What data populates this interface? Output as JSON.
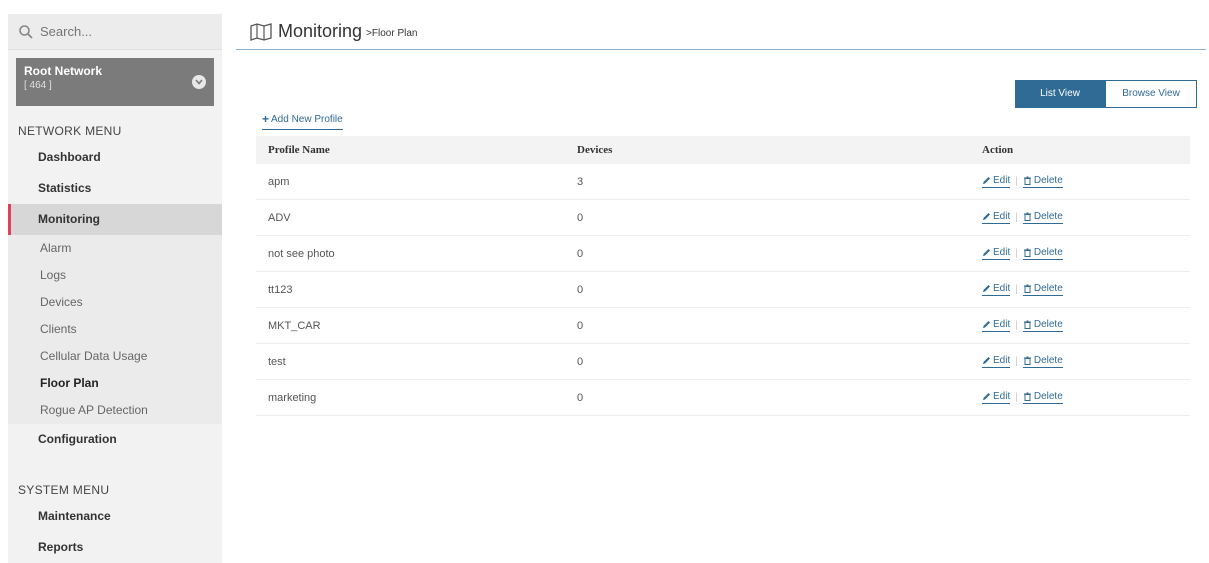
{
  "search": {
    "placeholder": "Search..."
  },
  "network": {
    "name": "Root Network",
    "count": "[ 464 ]"
  },
  "network_menu": {
    "heading": "NETWORK MENU",
    "items": [
      {
        "label": "Dashboard"
      },
      {
        "label": "Statistics"
      },
      {
        "label": "Monitoring"
      }
    ],
    "sub_items": [
      {
        "label": "Alarm"
      },
      {
        "label": "Logs"
      },
      {
        "label": "Devices"
      },
      {
        "label": "Clients"
      },
      {
        "label": "Cellular Data Usage"
      },
      {
        "label": "Floor Plan"
      },
      {
        "label": "Rogue AP Detection"
      }
    ],
    "configuration": "Configuration"
  },
  "system_menu": {
    "heading": "SYSTEM MENU",
    "items": [
      {
        "label": "Maintenance"
      },
      {
        "label": "Reports"
      }
    ]
  },
  "header": {
    "title": "Monitoring",
    "breadcrumb": ">Floor Plan"
  },
  "view_toggle": {
    "list": "List View",
    "browse": "Browse View"
  },
  "add_profile": "Add New Profile",
  "table": {
    "columns": [
      "Profile Name",
      "Devices",
      "Action"
    ],
    "rows": [
      {
        "name": "apm",
        "devices": "3"
      },
      {
        "name": "ADV",
        "devices": "0"
      },
      {
        "name": "not see photo",
        "devices": "0"
      },
      {
        "name": "tt123",
        "devices": "0"
      },
      {
        "name": "MKT_CAR",
        "devices": "0"
      },
      {
        "name": "test",
        "devices": "0"
      },
      {
        "name": "marketing",
        "devices": "0"
      }
    ],
    "edit_label": "Edit",
    "delete_label": "Delete"
  },
  "colors": {
    "accent": "#2f6b95",
    "active_marker": "#e0405a",
    "network_card": "#7b7b7b"
  },
  "icons": {
    "search": "search-icon",
    "map": "map-icon",
    "chevron": "chevron-down-icon",
    "edit": "pencil-icon",
    "delete": "trash-icon",
    "add": "plus-icon"
  }
}
